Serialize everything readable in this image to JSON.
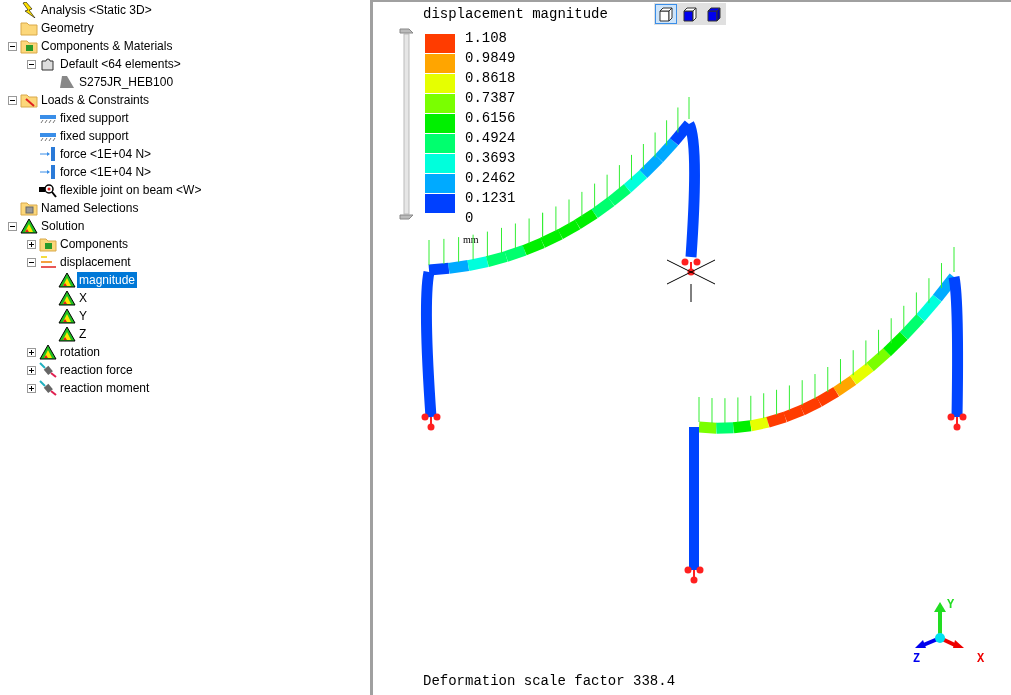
{
  "tree": [
    {
      "label": "Analysis <Static 3D>",
      "kind": "analysis",
      "selected": false
    },
    {
      "label": "Geometry",
      "kind": "folder",
      "selected": false
    },
    {
      "label": "Components & Materials",
      "kind": "parts-folder",
      "selected": false,
      "expanded": true,
      "children": [
        {
          "label": "Default <64 elements>",
          "kind": "part",
          "selected": false,
          "expanded": true,
          "children": [
            {
              "label": "S275JR_HEB100",
              "kind": "beam",
              "selected": false
            }
          ]
        }
      ]
    },
    {
      "label": "Loads & Constraints",
      "kind": "loads-folder",
      "selected": false,
      "expanded": true,
      "children": [
        {
          "label": "fixed support",
          "kind": "support",
          "selected": false
        },
        {
          "label": "fixed support",
          "kind": "support",
          "selected": false
        },
        {
          "label": "force <1E+04 N>",
          "kind": "force",
          "selected": false
        },
        {
          "label": "force <1E+04 N>",
          "kind": "force",
          "selected": false
        },
        {
          "label": "flexible joint on beam <W>",
          "kind": "joint",
          "selected": false
        }
      ]
    },
    {
      "label": "Named Selections",
      "kind": "named-folder",
      "selected": false
    },
    {
      "label": "Solution",
      "kind": "result",
      "selected": false,
      "expanded": true,
      "children": [
        {
          "label": "Components",
          "kind": "parts-folder",
          "selected": false,
          "expanded": false
        },
        {
          "label": "displacement",
          "kind": "displacement",
          "selected": false,
          "expanded": true,
          "children": [
            {
              "label": "magnitude",
              "kind": "result",
              "selected": true
            },
            {
              "label": "X",
              "kind": "result",
              "selected": false
            },
            {
              "label": "Y",
              "kind": "result",
              "selected": false
            },
            {
              "label": "Z",
              "kind": "result",
              "selected": false
            }
          ]
        },
        {
          "label": "rotation",
          "kind": "result",
          "selected": false,
          "expanded": false
        },
        {
          "label": "reaction force",
          "kind": "reaction",
          "selected": false,
          "expanded": false
        },
        {
          "label": "reaction moment",
          "kind": "reaction",
          "selected": false,
          "expanded": false
        }
      ]
    }
  ],
  "viewport": {
    "title": "displacement magnitude",
    "view_buttons": [
      {
        "kind": "wireframe",
        "selected": true
      },
      {
        "kind": "shaded",
        "selected": false
      },
      {
        "kind": "solid",
        "selected": false
      }
    ],
    "legend": {
      "bands": [
        {
          "color": "#ff3c00"
        },
        {
          "color": "#ffa500"
        },
        {
          "color": "#e6ff00"
        },
        {
          "color": "#7aff00"
        },
        {
          "color": "#00f000"
        },
        {
          "color": "#00ff6e"
        },
        {
          "color": "#00ffdc"
        },
        {
          "color": "#00aaff"
        },
        {
          "color": "#0040ff"
        }
      ],
      "labels": [
        "1.108",
        "0.9849",
        "0.8618",
        "0.7387",
        "0.6156",
        "0.4924",
        "0.3693",
        "0.2462",
        "0.1231",
        "0"
      ]
    },
    "unit": "mm",
    "axes": {
      "y": "Y",
      "z": "Z",
      "x": "X"
    },
    "footer": "Deformation scale factor 338.4"
  }
}
